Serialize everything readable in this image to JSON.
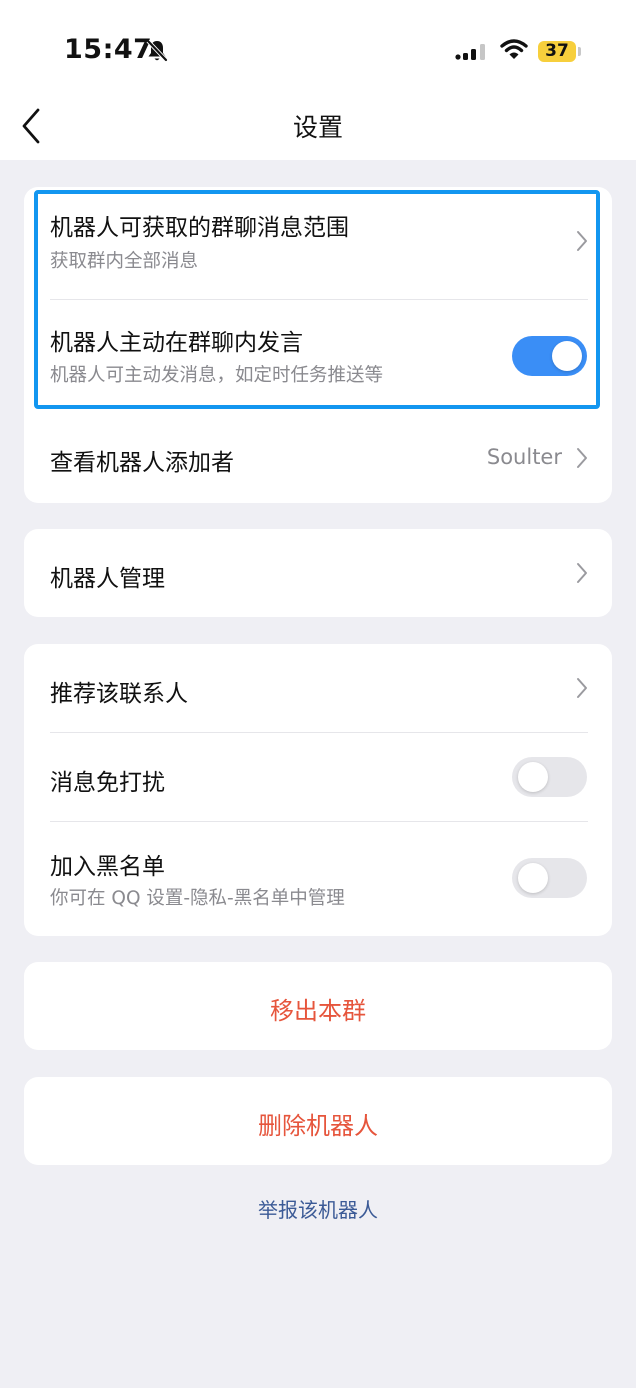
{
  "status_bar": {
    "time": "15:47",
    "battery": "37",
    "icons": [
      "bell-slash-icon",
      "cellular-signal-icon",
      "wifi-icon",
      "battery-icon"
    ]
  },
  "nav": {
    "title": "设置",
    "back_icon": "chevron-left-icon"
  },
  "group1": {
    "msg_scope": {
      "title": "机器人可获取的群聊消息范围",
      "subtitle": "获取群内全部消息"
    },
    "proactive": {
      "title": "机器人主动在群聊内发言",
      "subtitle": "机器人可主动发消息，如定时任务推送等",
      "enabled": true
    },
    "adder": {
      "title": "查看机器人添加者",
      "value": "Soulter"
    }
  },
  "group2": {
    "manage": {
      "title": "机器人管理"
    }
  },
  "group3": {
    "recommend": {
      "title": "推荐该联系人"
    },
    "dnd": {
      "title": "消息免打扰",
      "enabled": false
    },
    "blacklist": {
      "title": "加入黑名单",
      "subtitle": "你可在 QQ 设置-隐私-黑名单中管理",
      "enabled": false
    }
  },
  "actions": {
    "remove_from_group": "移出本群",
    "delete_bot": "删除机器人",
    "report": "举报该机器人"
  },
  "colors": {
    "accent_blue": "#3a8ef6",
    "danger_red": "#e6553c",
    "link_blue": "#3b5a96",
    "highlight_border": "#1296f0",
    "background": "#efeff4"
  }
}
